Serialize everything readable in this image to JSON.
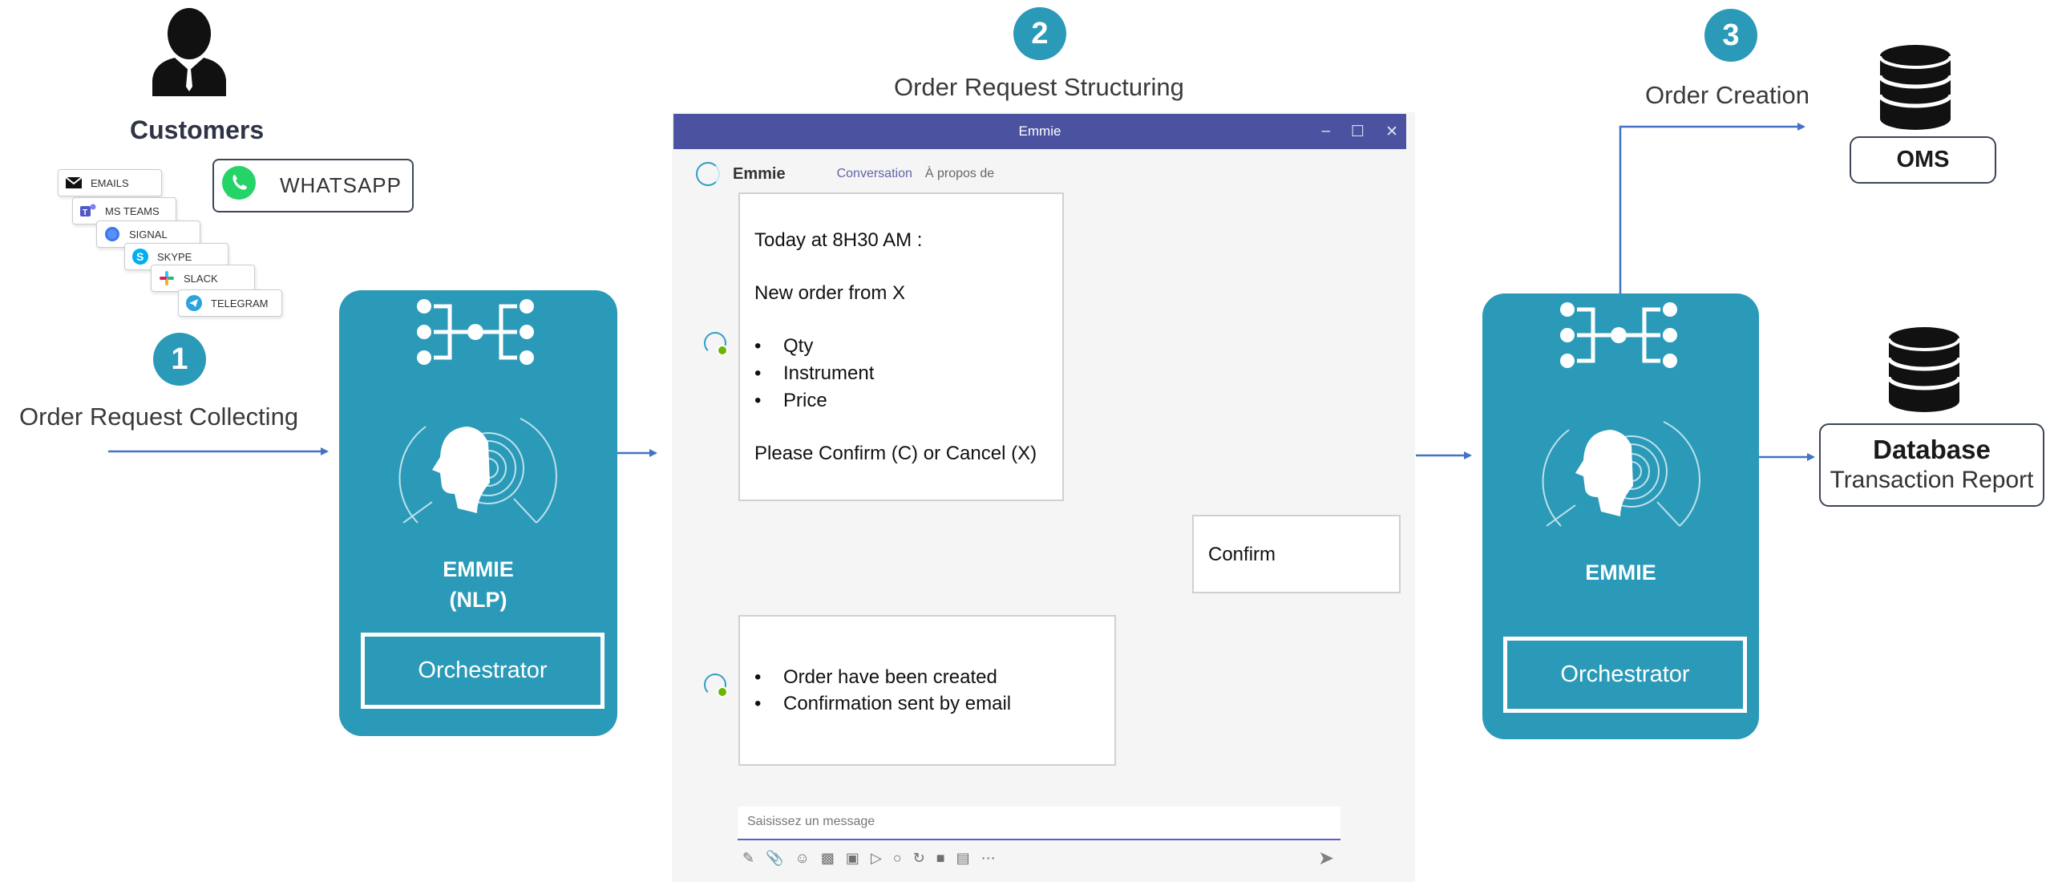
{
  "steps": [
    {
      "number": "1",
      "title": "Order Request Collecting"
    },
    {
      "number": "2",
      "title": "Order Request Structuring"
    },
    {
      "number": "3",
      "title": "Order Creation"
    }
  ],
  "customers": {
    "title": "Customers",
    "channels": [
      "EMAILS",
      "MS TEAMS",
      "SIGNAL",
      "SKYPE",
      "SLACK",
      "TELEGRAM"
    ],
    "whatsapp": "WHATSAPP"
  },
  "engine_left": {
    "name": "EMMIE",
    "subtitle": "(NLP)",
    "orchestrator": "Orchestrator"
  },
  "engine_right": {
    "name": "EMMIE",
    "orchestrator": "Orchestrator"
  },
  "chat": {
    "window_title": "Emmie",
    "bot_name": "Emmie",
    "tabs": [
      "Conversation",
      "À propos de"
    ],
    "message1": {
      "line1": "Today at 8H30 AM :",
      "line2": "New order from X",
      "bullets": [
        "Qty",
        "Instrument",
        "Price"
      ],
      "line3": "Please Confirm (C) or Cancel (X)"
    },
    "reply": "Confirm",
    "message2": {
      "bullets": [
        "Order have been created",
        "Confirmation sent by email"
      ]
    },
    "compose_placeholder": "Saisissez un message"
  },
  "targets": {
    "oms": "OMS",
    "database_title": "Database",
    "database_subtitle": "Transaction Report"
  },
  "colors": {
    "teal": "#2b9ab8",
    "arrow": "#4472c4",
    "teams_bar": "#4b53a0"
  }
}
